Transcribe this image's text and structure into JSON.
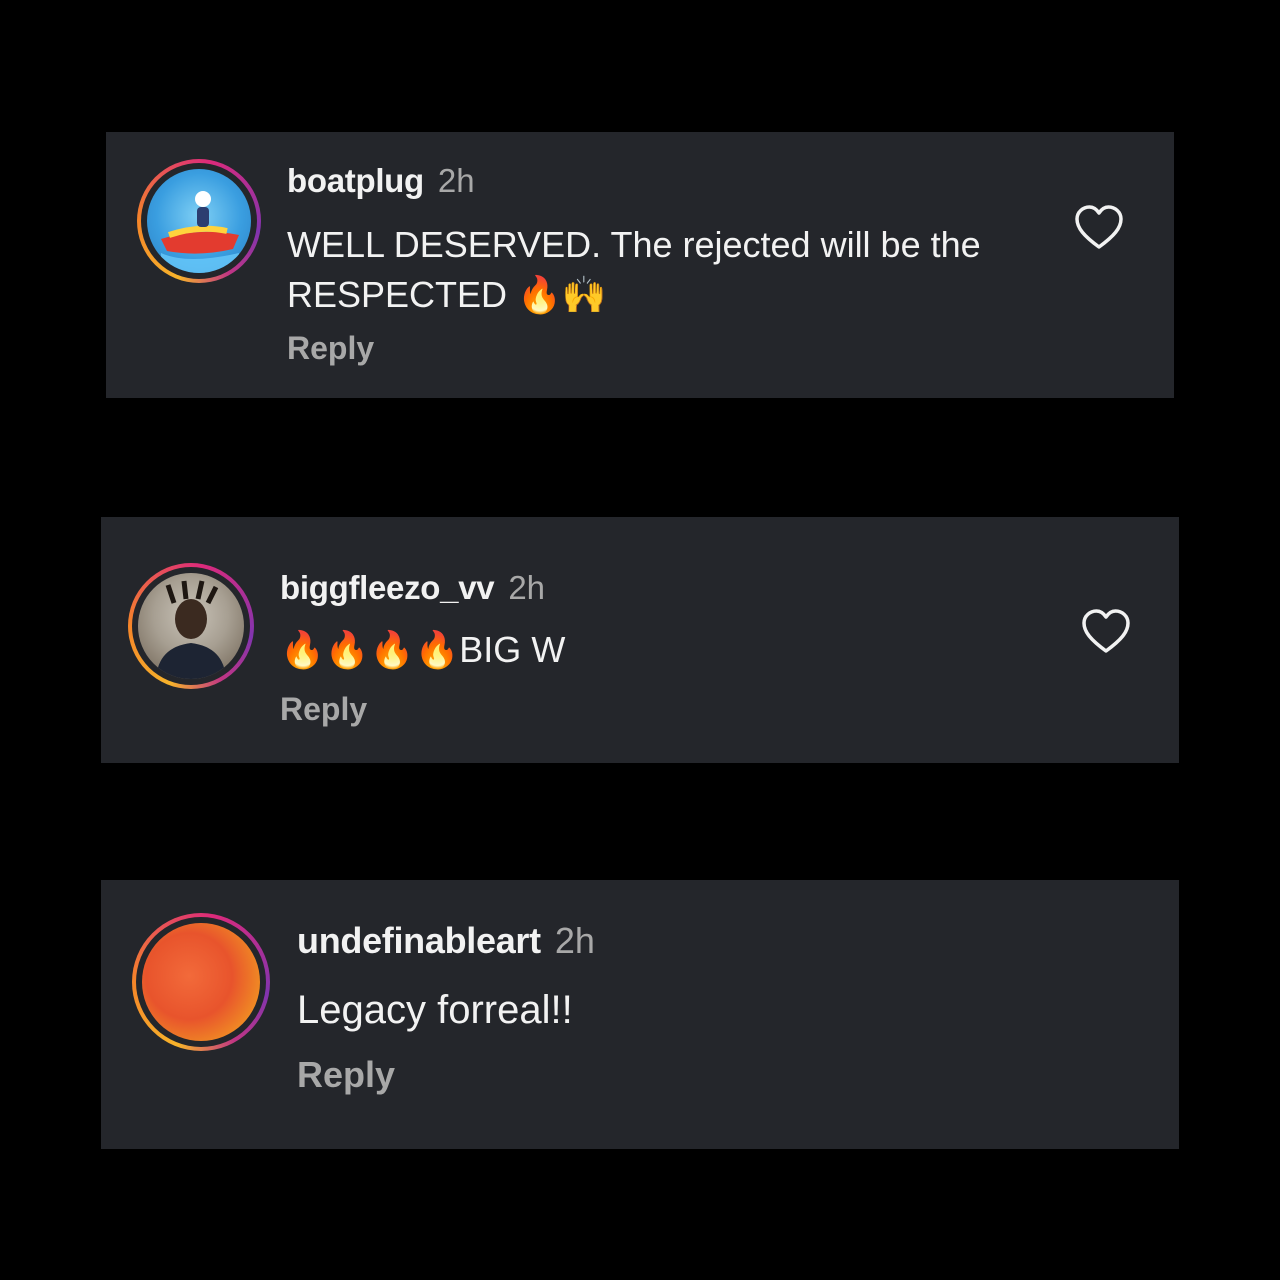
{
  "comments": [
    {
      "username": "boatplug",
      "time": "2h",
      "text": "WELL DESERVED. The rejected will be the RESPECTED 🔥🙌",
      "reply_label": "Reply",
      "avatar_icon": "boat-avatar",
      "has_like": true
    },
    {
      "username": "biggfleezo_vv",
      "time": "2h",
      "text": "🔥🔥🔥🔥BIG W",
      "reply_label": "Reply",
      "avatar_icon": "portrait-avatar",
      "has_like": true
    },
    {
      "username": "undefinableart",
      "time": "2h",
      "text": "Legacy forreal!!",
      "reply_label": "Reply",
      "avatar_icon": "orange-gradient-avatar",
      "has_like": false
    }
  ],
  "colors": {
    "background": "#000000",
    "card": "#24262b",
    "text_primary": "#f2f2f2",
    "text_secondary": "#a8a8a8",
    "story_ring": [
      "#f7b32b",
      "#f58529",
      "#dd2a7b",
      "#8134af"
    ]
  }
}
